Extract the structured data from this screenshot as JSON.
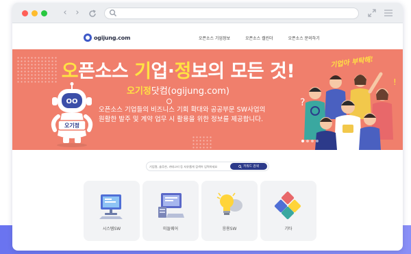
{
  "browser": {
    "nav": {
      "back": "‹",
      "forward": "›"
    }
  },
  "site": {
    "logo": "ogijung.com",
    "nav_items": [
      "오픈소스 기업정보",
      "오픈소스 캘린더",
      "오픈소스 문의하기"
    ]
  },
  "hero": {
    "title_parts": [
      "오",
      "픈소스 ",
      "기",
      "업·",
      "정",
      "보의 모든 것!"
    ],
    "subtitle_highlight": "오기정",
    "subtitle_rest": "닷컴(ogijung.com)",
    "description_lines": [
      "오픈소스 기업들의 비즈니스 기회 확대와 공공부문 SW사업의",
      "원활한 발주 및 계약 업무 시 활용을 위한 정보를 제공합니다."
    ],
    "script_text": "기업아 부탁해!",
    "mascot_badge": "오기정",
    "mascot_face": "OO",
    "slide_count": 4,
    "slide_active": 0
  },
  "search": {
    "placeholder": "기업명, 솔루션, 카테고리 등 자유롭게 검색어 입력하세요",
    "button_label": "키워드 검색"
  },
  "categories": [
    {
      "label": "시스템SW",
      "icon": "desktop-computer-icon"
    },
    {
      "label": "미들웨어",
      "icon": "server-computer-icon"
    },
    {
      "label": "응용SW",
      "icon": "lightbulb-icon"
    },
    {
      "label": "기타",
      "icon": "puzzle-icon"
    }
  ],
  "colors": {
    "hero_bg": "#f07f6c",
    "highlight": "#ffe243",
    "button": "#2c3a8a",
    "logo": "#3d58c7"
  }
}
